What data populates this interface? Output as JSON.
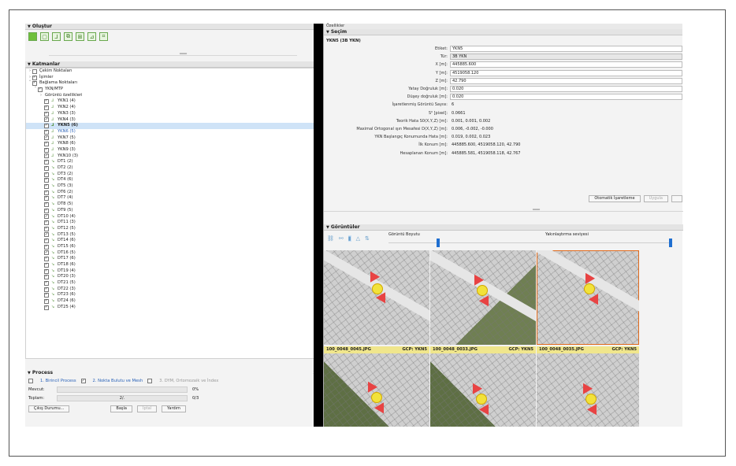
{
  "left": {
    "olustur_header": "Oluştur",
    "katmanlar_header": "Katmanlar",
    "tree": {
      "cekim": "Çekim Noktaları",
      "isimler": "İşimler",
      "baglama": "Bağlama Noktaları",
      "ykn_mtp": "YKN/MTP",
      "goruntu_ozellikleri": "Görüntü özellikleri",
      "items": [
        "YKN1 (4)",
        "YKN2 (4)",
        "YKN3 (3)",
        "YKN4 (3)",
        "YKN5 (6)",
        "YKN6 (5)",
        "YKN7 (5)",
        "YKN8 (6)",
        "YKN9 (3)",
        "YKN10 (3)",
        "DT1 (2)",
        "DT2 (2)",
        "DT3 (2)",
        "DT4 (6)",
        "DT5 (3)",
        "DT6 (2)",
        "DT7 (4)",
        "DT8 (5)",
        "DT9 (5)",
        "DT10 (4)",
        "DT11 (3)",
        "DT12 (5)",
        "DT13 (5)",
        "DT14 (6)",
        "DT15 (6)",
        "DT16 (5)",
        "DT17 (6)",
        "DT18 (6)",
        "DT19 (4)",
        "DT20 (3)",
        "DT21 (5)",
        "DT22 (3)",
        "DT23 (6)",
        "DT24 (6)",
        "DT25 (4)"
      ]
    },
    "process": {
      "header": "Process",
      "step1": "1. Birincil Process",
      "step2": "2. Nokta Bulutu ve Mesh",
      "step3": "3. DYM, Ortomozaik ve İndex",
      "mevcut_label": "Mevcut:",
      "mevcut_pct": "0%",
      "toplam_label": "Toplam:",
      "toplam_mid": "2/.",
      "toplam_pct": "0/3",
      "cikis_btn": "Çıkış Durumu...",
      "basla_btn": "Başla",
      "iptal_btn": "İptal",
      "yardim_btn": "Yardım"
    }
  },
  "right": {
    "panel_title": "Özellikler",
    "secim_header": "Seçim",
    "point_title": "YKN5 (3B YKN)",
    "fields": {
      "etiket_label": "Etiket:",
      "etiket": "YKN5",
      "tur_label": "Tür:",
      "tur": "3B YKN",
      "x_label": "X [m]:",
      "x": "445885.600",
      "y_label": "Y [m]:",
      "y": "4519058.120",
      "z_label": "Z [m]:",
      "z": "42.790",
      "yatay_label": "Yatay Doğruluk [m]:",
      "yatay": "0.020",
      "dusey_label": "Düşey doğruluk [m]:",
      "dusey": "0.020",
      "isaret_label": "İşaretlenmiş Görüntü Sayısı:",
      "isaret": "6",
      "s0_label": "S⁰ [pixel]:",
      "s0": "0.0661",
      "teorik_label": "Teorik Hata S0(X,Y,Z) [m]:",
      "teorik": "0.001, 0.001, 0.002",
      "maks_label": "Maximal Ortogonal ışın Mesafesi D(X,Y,Z) [m]:",
      "maks": "0.006, -0.002, -0.000",
      "ykn_hata_label": "YKN Başlangıç Konumunda Hata [m]:",
      "ykn_hata": "0.019, 0.002, 0.023",
      "ilk_label": "İlk Konum [m]:",
      "ilk": "445885.600, 4519058.120, 42.790",
      "hesap_label": "Hesaplanan Konum [m]:",
      "hesap": "445885.581, 4519058.118, 42.767"
    },
    "otomatik_btn": "Otomatik İşaretleme",
    "uygula_btn": "Uygula",
    "goruntuler_header": "Görüntüler",
    "goruntu_boyutu": "Görüntü Boyutu",
    "yakinlastirma": "Yakınlaştırma seviyesi",
    "captions": [
      {
        "file": "100_0048_0045.JPG",
        "gcp": "GCP: YKN5"
      },
      {
        "file": "100_0048_0033.JPG",
        "gcp": "GCP: YKN5"
      },
      {
        "file": "100_0048_0035.JPG",
        "gcp": "GCP: YKN5"
      }
    ]
  }
}
